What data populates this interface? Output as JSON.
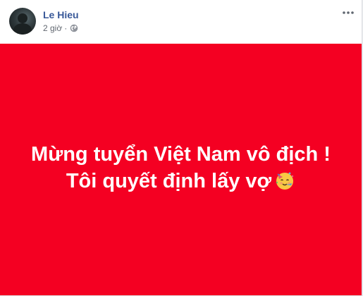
{
  "post": {
    "author": "Le Hieu",
    "time": "2 giờ",
    "separator": "·",
    "privacy_icon": "globe-icon",
    "more_icon": "more-options-icon",
    "background_color": "#f40022",
    "text_lines": [
      "Mừng tuyển Việt Nam vô địch !",
      "Tôi quyết định lấy vợ"
    ],
    "emoji": "partying-face-emoji"
  }
}
